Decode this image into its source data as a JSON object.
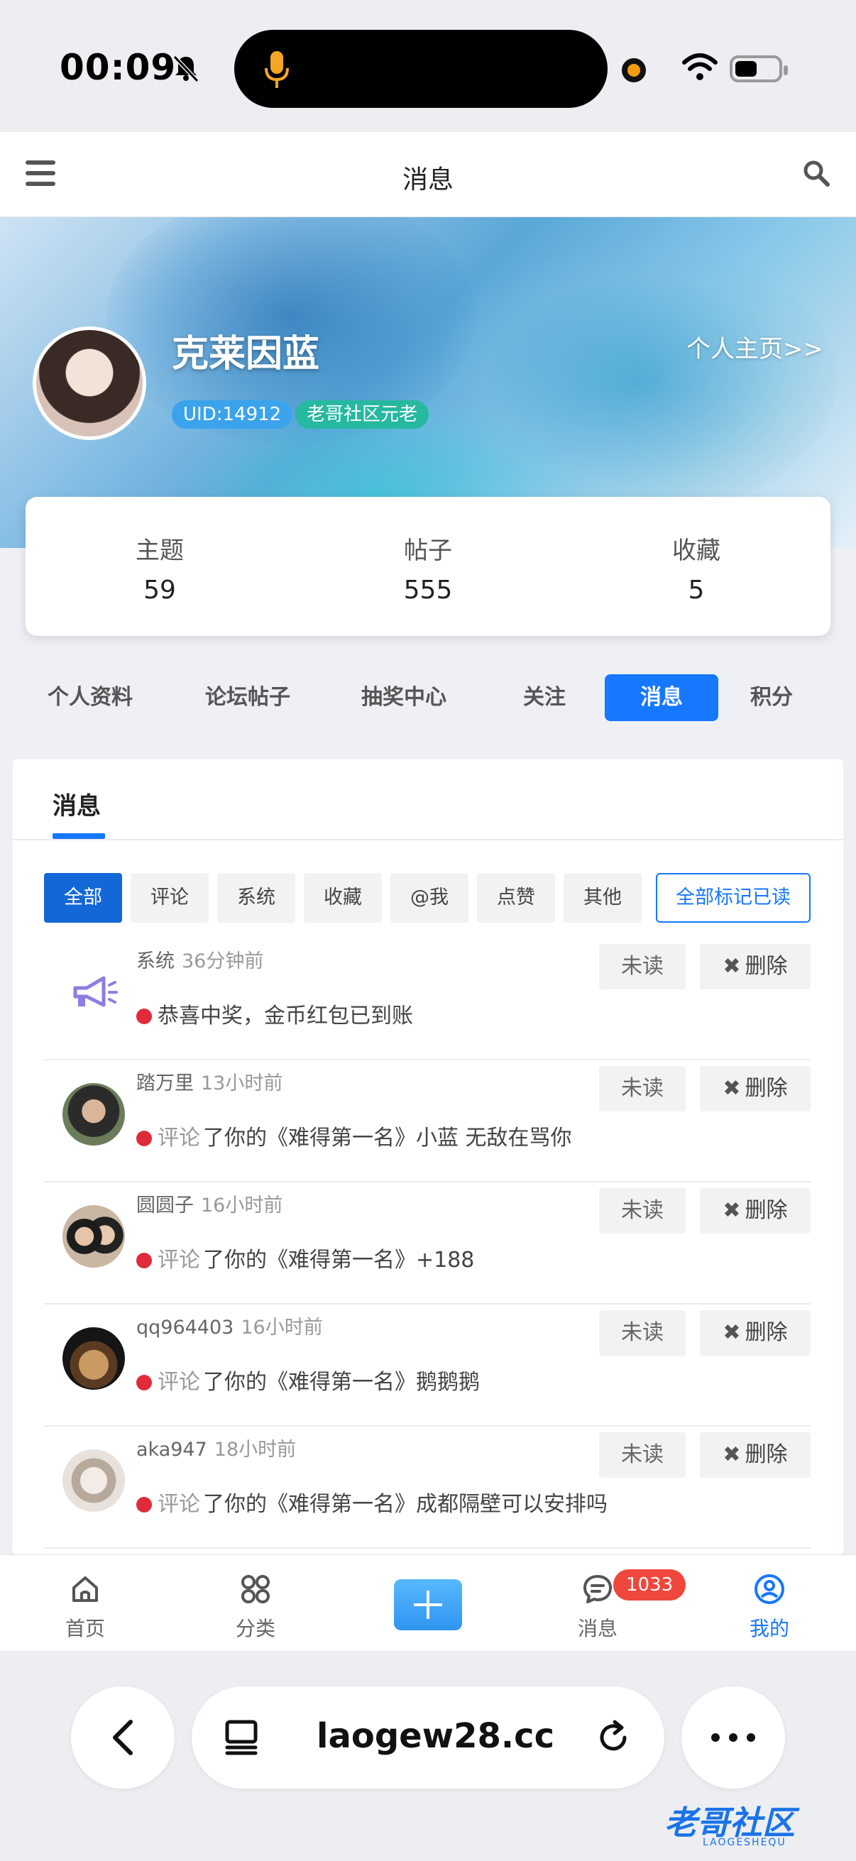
{
  "status": {
    "time": "00:09"
  },
  "nav": {
    "title": "消息"
  },
  "profile": {
    "name": "克莱因蓝",
    "homepage_link": "个人主页>>",
    "uid": "UID:14912",
    "level": "老哥社区元老"
  },
  "stats": [
    {
      "label": "主题",
      "value": "59"
    },
    {
      "label": "帖子",
      "value": "555"
    },
    {
      "label": "收藏",
      "value": "5"
    }
  ],
  "profile_tabs": [
    "个人资料",
    "论坛帖子",
    "抽奖中心",
    "关注",
    "消息",
    "积分"
  ],
  "panel": {
    "tab": "消息",
    "filters": [
      "全部",
      "评论",
      "系统",
      "收藏",
      "@我",
      "点赞",
      "其他"
    ],
    "mark_all": "全部标记已读",
    "unread_label": "未读",
    "delete_label": "删除",
    "messages": [
      {
        "sender": "系统",
        "time": "36分钟前",
        "kind": "",
        "text": "恭喜中奖，金币红包已到账",
        "avatar": "megaphone-icon"
      },
      {
        "sender": "踏万里",
        "time": "13小时前",
        "kind": "评论",
        "text": "了你的《难得第一名》小蓝 无敌在骂你",
        "avatar": "user-avatar"
      },
      {
        "sender": "圆圆子",
        "time": "16小时前",
        "kind": "评论",
        "text": "了你的《难得第一名》+188",
        "avatar": "user-avatar"
      },
      {
        "sender": "qq964403",
        "time": "16小时前",
        "kind": "评论",
        "text": "了你的《难得第一名》鹅鹅鹅",
        "avatar": "user-avatar"
      },
      {
        "sender": "aka947",
        "time": "18小时前",
        "kind": "评论",
        "text": "了你的《难得第一名》成都隔壁可以安排吗",
        "avatar": "user-avatar"
      }
    ]
  },
  "tabbar": {
    "items": [
      "首页",
      "分类",
      "消息",
      "我的"
    ],
    "message_badge": "1033"
  },
  "browser": {
    "url": "laogew28.cc"
  },
  "watermark": {
    "text": "老哥社区",
    "sub": "LAOGESHEQU"
  },
  "colors": {
    "accent": "#1677ff",
    "badge": "#f0473c",
    "unread_dot": "#e02b3a"
  }
}
